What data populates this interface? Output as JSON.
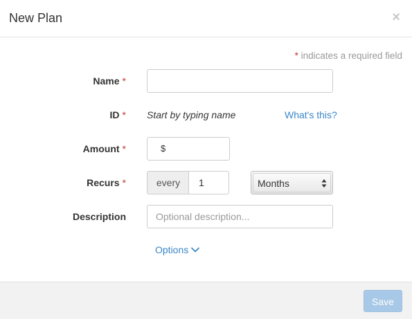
{
  "modal": {
    "title": "New Plan",
    "close_glyph": "×",
    "required_note_star": "*",
    "required_note_text": "indicates a required field"
  },
  "form": {
    "name": {
      "label": "Name",
      "required_mark": "*",
      "value": "",
      "placeholder": ""
    },
    "id": {
      "label": "ID",
      "required_mark": "*",
      "hint": "Start by typing name",
      "help_link": "What's this?"
    },
    "amount": {
      "label": "Amount",
      "required_mark": "*",
      "currency_prefix": "$",
      "value": ""
    },
    "recurs": {
      "label": "Recurs",
      "required_mark": "*",
      "every_label": "every",
      "count_value": "1",
      "period_selected": "Months"
    },
    "description": {
      "label": "Description",
      "value": "",
      "placeholder": "Optional description..."
    },
    "options_label": "Options"
  },
  "footer": {
    "save_label": "Save"
  },
  "icons": {
    "close": "close-icon",
    "options_chevron": "chevron-down-icon",
    "select_arrows": "updown-arrows-icon"
  },
  "colors": {
    "required_star": "#c0392b",
    "link": "#3a87c7",
    "save_button_disabled": "#a7c8e6"
  }
}
